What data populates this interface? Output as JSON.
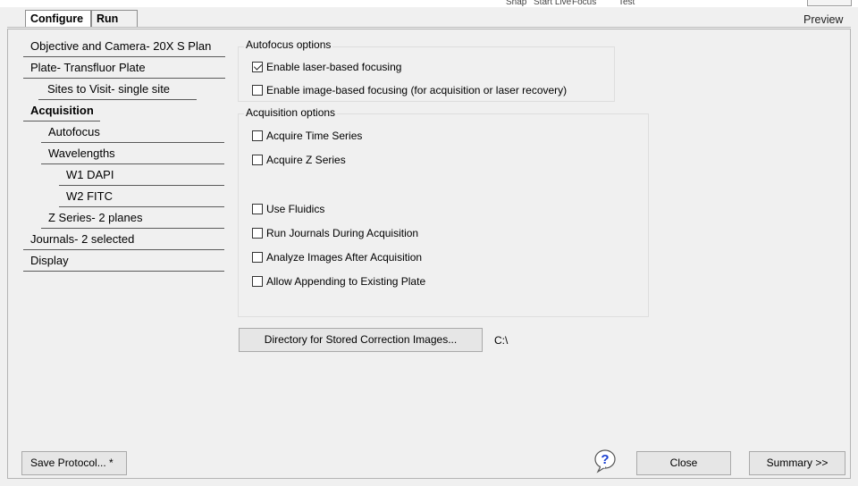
{
  "header": {
    "top_labels": [
      "Snap",
      "Start Live",
      "Focus",
      "Test"
    ],
    "preview_label": "Preview"
  },
  "tabs": [
    {
      "label": "Configure",
      "active": true
    },
    {
      "label": "Run",
      "active": false
    }
  ],
  "tree": [
    {
      "label": "Objective and Camera- 20X S Plan",
      "level": 0
    },
    {
      "label": "Plate- Transfluor Plate",
      "level": 0
    },
    {
      "label": "Sites to Visit- single site",
      "level": 1
    },
    {
      "label": "Acquisition",
      "level": 0,
      "selected": true
    },
    {
      "label": "Autofocus",
      "level": 1
    },
    {
      "label": "Wavelengths",
      "level": 1
    },
    {
      "label": "W1 DAPI",
      "level": 2
    },
    {
      "label": "W2 FITC",
      "level": 2
    },
    {
      "label": "Z Series- 2 planes",
      "level": 1
    },
    {
      "label": "Journals- 2 selected",
      "level": 0
    },
    {
      "label": "Display",
      "level": 0
    }
  ],
  "autofocus": {
    "title": "Autofocus options",
    "options": [
      {
        "label": "Enable laser-based focusing",
        "checked": true
      },
      {
        "label": "Enable image-based focusing (for acquisition or laser recovery)",
        "checked": false
      }
    ]
  },
  "acquisition": {
    "title": "Acquisition options",
    "options": [
      {
        "label": "Acquire Time Series",
        "checked": false
      },
      {
        "label": "Acquire Z Series",
        "checked": false
      },
      {
        "label": "Use Fluidics",
        "checked": false
      },
      {
        "label": "Run Journals During Acquisition",
        "checked": false
      },
      {
        "label": "Analyze Images After Acquisition",
        "checked": false
      },
      {
        "label": "Allow Appending to Existing Plate",
        "checked": false
      }
    ]
  },
  "directory": {
    "button_label": "Directory for Stored Correction Images...",
    "path": "C:\\"
  },
  "footer": {
    "save_label": "Save Protocol... *",
    "close_label": "Close",
    "summary_label": "Summary >>",
    "help_icon": "question-mark-speech-bubble"
  }
}
